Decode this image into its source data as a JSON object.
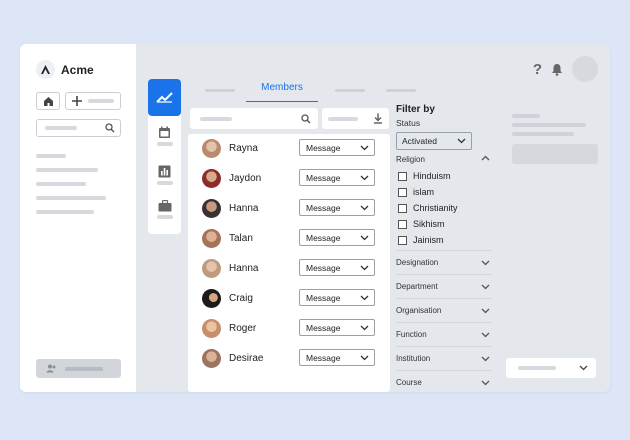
{
  "app": {
    "name": "Acme"
  },
  "tabs": {
    "active_label": "Members"
  },
  "members": [
    {
      "name": "Rayna",
      "action": "Message",
      "avatar_color": "#b98a6e"
    },
    {
      "name": "Jaydon",
      "action": "Message",
      "avatar_color": "#8a2d2d"
    },
    {
      "name": "Hanna",
      "action": "Message",
      "avatar_color": "#3a3230"
    },
    {
      "name": "Talan",
      "action": "Message",
      "avatar_color": "#a4735a"
    },
    {
      "name": "Hanna",
      "action": "Message",
      "avatar_color": "#c09a7e"
    },
    {
      "name": "Craig",
      "action": "Message",
      "avatar_color": "#1f1a18"
    },
    {
      "name": "Roger",
      "action": "Message",
      "avatar_color": "#c68f6b"
    },
    {
      "name": "Desirae",
      "action": "Message",
      "avatar_color": "#9b7460"
    }
  ],
  "filter": {
    "title": "Filter by",
    "status_label": "Status",
    "status_value": "Activated",
    "religion_label": "Religion",
    "religion_options": [
      "Hinduism",
      "islam",
      "Christianity",
      "Sikhism",
      "Jainism"
    ],
    "sections": [
      "Designation",
      "Department",
      "Organisation",
      "Function",
      "Institution",
      "Course"
    ]
  },
  "colors": {
    "accent": "#1a73e8",
    "background": "#dde6f6",
    "panel": "#e4e7ec"
  },
  "icons": {
    "logo": "acme-logo-icon",
    "help": "help-icon",
    "notifications": "bell-icon"
  }
}
